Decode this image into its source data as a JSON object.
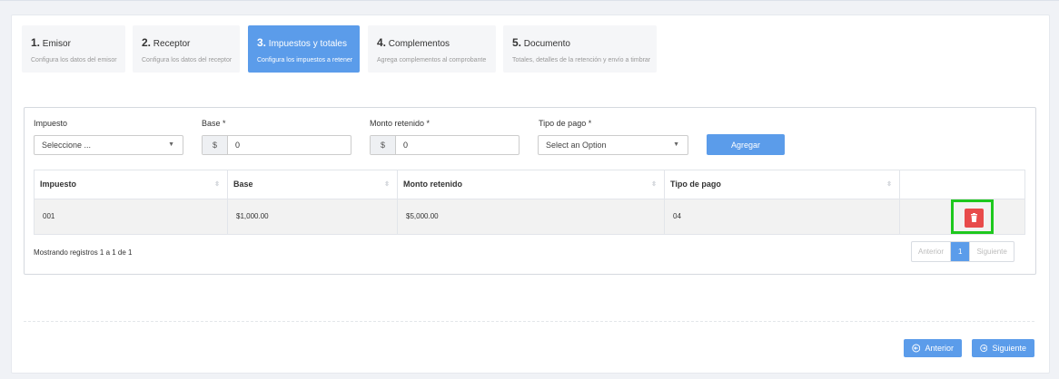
{
  "steps": [
    {
      "num": "1.",
      "title": "Emisor",
      "desc": "Configura los datos del emisor"
    },
    {
      "num": "2.",
      "title": "Receptor",
      "desc": "Configura los datos del receptor"
    },
    {
      "num": "3.",
      "title": "Impuestos y totales",
      "desc": "Configura los impuestos a retener"
    },
    {
      "num": "4.",
      "title": "Complementos",
      "desc": "Agrega complementos al comprobante"
    },
    {
      "num": "5.",
      "title": "Documento",
      "desc": "Totales, detalles de la retención y envío a timbrar"
    }
  ],
  "form": {
    "impuesto_label": "Impuesto",
    "impuesto_value": "Seleccione ...",
    "base_label": "Base *",
    "base_addon": "$",
    "base_value": "0",
    "monto_label": "Monto retenido *",
    "monto_addon": "$",
    "monto_value": "0",
    "tipo_label": "Tipo de pago *",
    "tipo_value": "Select an Option",
    "add_label": "Agregar"
  },
  "table": {
    "headers": [
      "Impuesto",
      "Base",
      "Monto retenido",
      "Tipo de pago"
    ],
    "rows": [
      {
        "impuesto": "001",
        "base": "$1,000.00",
        "monto": "$5,000.00",
        "tipo": "04"
      }
    ],
    "info": "Mostrando registros 1 a 1 de 1",
    "pager": {
      "prev": "Anterior",
      "current": "1",
      "next": "Siguiente"
    }
  },
  "footer": {
    "prev_label": "Anterior",
    "next_label": "Siguiente"
  },
  "colors": {
    "accent": "#5b9cea",
    "danger": "#e84b4b",
    "highlight": "#1ec81e"
  }
}
